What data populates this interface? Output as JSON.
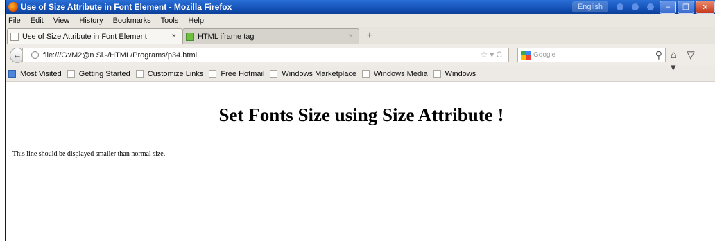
{
  "window": {
    "title": "Use of Size Attribute in Font Element - Mozilla Firefox",
    "tray_text": "English"
  },
  "menu": [
    "File",
    "Edit",
    "View",
    "History",
    "Bookmarks",
    "Tools",
    "Help"
  ],
  "tabs": [
    {
      "label": "Use of Size Attribute in Font Element",
      "close": "×"
    },
    {
      "label": "HTML iframe tag",
      "close": "×"
    }
  ],
  "new_tab": "+",
  "nav": {
    "url": "file:///G:/M2@n Si.-/HTML/Programs/p34.html",
    "search_placeholder": "Google"
  },
  "bookmarks": [
    "Most Visited",
    "Getting Started",
    "Customize Links",
    "Free Hotmail",
    "Windows Marketplace",
    "Windows Media",
    "Windows"
  ],
  "page": {
    "heading": "Set Fonts Size using Size Attribute !",
    "paragraph": "This line should be displayed smaller than normal size."
  },
  "colors": {
    "titlebar": "#1552b8",
    "chrome": "#eae7e1"
  }
}
